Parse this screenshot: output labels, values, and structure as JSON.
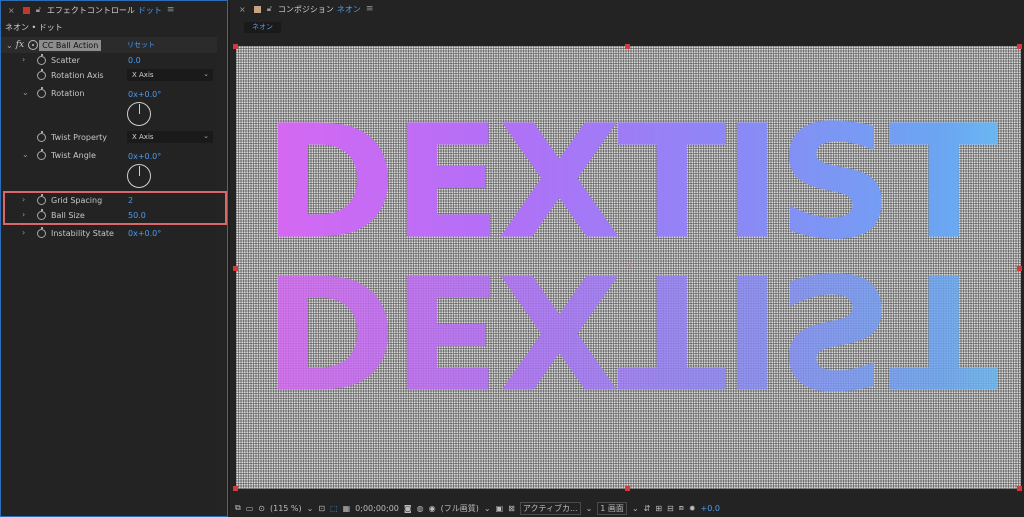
{
  "effect_controls": {
    "tab_title": "エフェクトコントロール",
    "tab_layer": "ドット",
    "subheading": "ネオン • ドット",
    "effect_label": "fx",
    "effect_name": "CC Ball Action",
    "reset_label": "リセット",
    "properties": [
      {
        "label": "Scatter",
        "value": "0.0"
      },
      {
        "label": "Rotation Axis",
        "value": "X Axis"
      },
      {
        "label": "Rotation",
        "value": "0x+0.0°"
      },
      {
        "label": "Twist Property",
        "value": "X Axis"
      },
      {
        "label": "Twist Angle",
        "value": "0x+0.0°"
      },
      {
        "label": "Grid Spacing",
        "value": "2"
      },
      {
        "label": "Ball Size",
        "value": "50.0"
      },
      {
        "label": "Instability State",
        "value": "0x+0.0°"
      }
    ]
  },
  "composition": {
    "tab_title": "コンポジション",
    "tab_name": "ネオン",
    "subtab": "ネオン",
    "canvas_text": "DEXTIST",
    "colors": {
      "gradient_start": "#e465f0",
      "gradient_mid": "#8e86f6",
      "gradient_end": "#6bd2f0",
      "handle": "#d9363e"
    }
  },
  "toolbar": {
    "zoom": "(115 %)",
    "timecode": "0;00;00;00",
    "resolution": "(フル画質)",
    "view": "アクティブカ...",
    "layout": "1 画面",
    "exposure": "+0.0"
  }
}
